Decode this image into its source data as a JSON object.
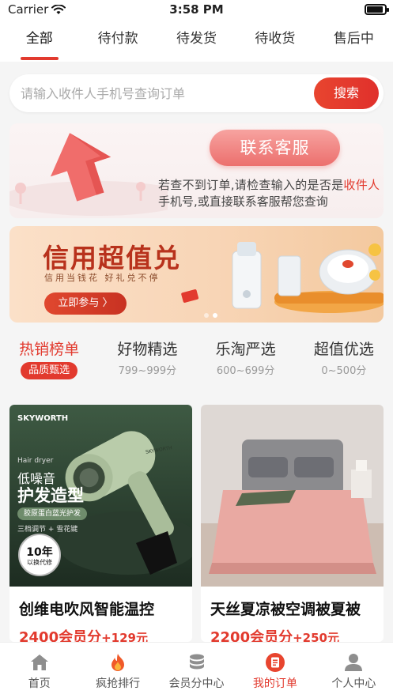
{
  "status_bar": {
    "carrier": "Carrier",
    "time": "3:58 PM",
    "battery_level": 0.9
  },
  "tabs": [
    {
      "label": "全部",
      "active": true
    },
    {
      "label": "待付款",
      "active": false
    },
    {
      "label": "待发货",
      "active": false
    },
    {
      "label": "待收货",
      "active": false
    },
    {
      "label": "售后中",
      "active": false
    }
  ],
  "search": {
    "placeholder": "请输入收件人手机号查询订单",
    "button_label": "搜索"
  },
  "service": {
    "button_label": "联系客服",
    "text_part1": "若查不到订单,请检查输入的是否是",
    "text_highlight": "收件人",
    "text_part2": "手机号,或直接联系客服帮您查询"
  },
  "banner": {
    "title": "信用超值兑",
    "subtitle": "信用当钱花 好礼兑不停",
    "button_label": "立即参与 〉",
    "slide_count": 2,
    "active_slide": 1
  },
  "categories": [
    {
      "title": "热销榜单",
      "badge": "品质甄选",
      "active": true
    },
    {
      "title": "好物精选",
      "sub": "799~999分",
      "active": false
    },
    {
      "title": "乐淘严选",
      "sub": "600~699分",
      "active": false
    },
    {
      "title": "超值优选",
      "sub": "0~500分",
      "active": false
    }
  ],
  "products": [
    {
      "name": "创维电吹风智能温控",
      "price_points": "2400会员分",
      "price_cash": "+129元",
      "image": {
        "brand": "SKYWORTH",
        "brand_small": "SKYWORTH",
        "line1": "Hair dryer",
        "line2": "低噪音",
        "line3": "护发造型",
        "pill": "胶原蛋白蓝光护发",
        "line4": "三档调节 + 雪花键",
        "seal_big": "10年",
        "seal_small": "以换代修"
      }
    },
    {
      "name": "天丝夏凉被空调被夏被",
      "price_points": "2200会员分",
      "price_cash": "+250元"
    }
  ],
  "bottom_nav": [
    {
      "label": "首页",
      "icon": "home-icon",
      "active": false
    },
    {
      "label": "疯抢排行",
      "icon": "fire-icon",
      "active": false
    },
    {
      "label": "会员分中心",
      "icon": "coins-icon",
      "active": false
    },
    {
      "label": "我的订单",
      "icon": "order-icon",
      "active": true
    },
    {
      "label": "个人中心",
      "icon": "user-icon",
      "active": false
    }
  ],
  "colors": {
    "accent": "#e23a2e",
    "background": "#f5f5f5"
  }
}
